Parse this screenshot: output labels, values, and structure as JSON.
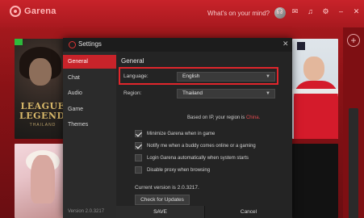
{
  "app": {
    "brand": "Garena",
    "status": "What's on your mind?",
    "top_icons": [
      "headset-icon",
      "chat-bubble-icon",
      "bell-icon",
      "gear-icon",
      "minimize-icon",
      "close-icon"
    ]
  },
  "cards": {
    "lol_title": "LEAGUE\nLEGENDS",
    "lol_sub": "THAILAND"
  },
  "settings": {
    "title": "Settings",
    "sidebar": {
      "items": [
        {
          "label": "General",
          "active": true
        },
        {
          "label": "Chat",
          "active": false
        },
        {
          "label": "Audio",
          "active": false
        },
        {
          "label": "Game",
          "active": false
        },
        {
          "label": "Themes",
          "active": false
        }
      ],
      "version": "Version 2.0.3217"
    },
    "general": {
      "heading": "General",
      "language_label": "Language:",
      "language_value": "English",
      "region_label": "Region:",
      "region_value": "Thailand",
      "ip_note_prefix": "Based on IP, your region is ",
      "ip_note_country": "China.",
      "checkboxes": [
        {
          "label": "Minimize Garena when in game",
          "checked": true
        },
        {
          "label": "Notify me when a buddy comes online or a gaming",
          "checked": true
        },
        {
          "label": "Login Garena automatically when system starts",
          "checked": false
        },
        {
          "label": "Disable proxy when browsing",
          "checked": false
        }
      ],
      "current_version": "Current version is 2.0.3217.",
      "update_button": "Check for Updates"
    },
    "footer": {
      "save": "SAVE",
      "cancel": "Cancel"
    },
    "colors": {
      "accent": "#c8232a",
      "highlight_border": "#e0262c"
    }
  }
}
